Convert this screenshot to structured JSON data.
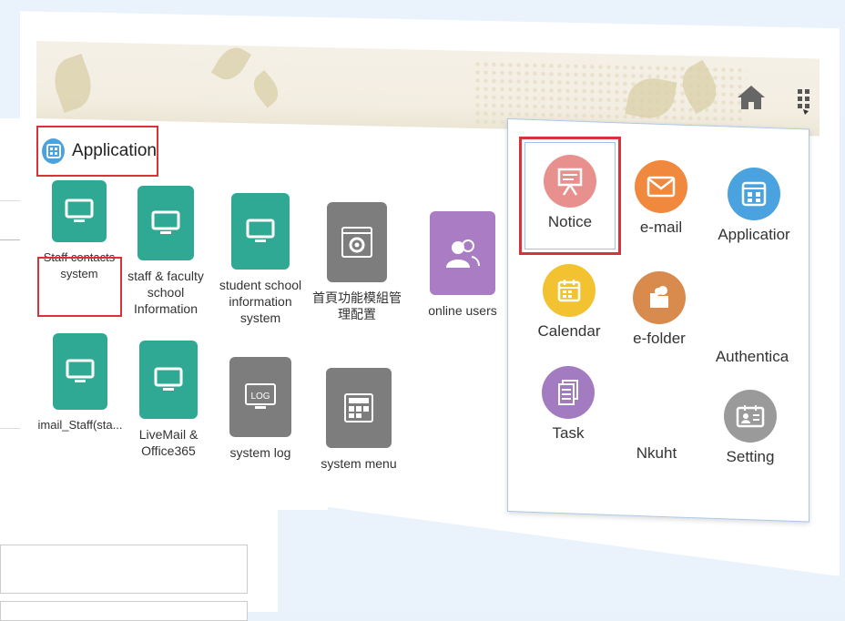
{
  "header": {
    "section_title": "Application"
  },
  "apps": [
    {
      "label": "Staff contacts system",
      "icon": "monitor-icon",
      "color": "#2fa894"
    },
    {
      "label": "staff & faculty school Information",
      "icon": "monitor-icon",
      "color": "#2fa894"
    },
    {
      "label": "student school information system",
      "icon": "monitor-icon",
      "color": "#2fa894"
    },
    {
      "label": "首頁功能模組管理配置",
      "icon": "gear-window-icon",
      "color": "#7d7d7d"
    },
    {
      "label": "online users",
      "icon": "users-icon",
      "color": "#a97cc4"
    },
    {
      "label": "imail_Staff(sta...",
      "icon": "monitor-icon",
      "color": "#2fa894"
    },
    {
      "label": "LiveMail & Office365",
      "icon": "monitor-icon",
      "color": "#2fa894"
    },
    {
      "label": "system log",
      "icon": "log-icon",
      "color": "#7d7d7d",
      "badge": "LOG"
    },
    {
      "label": "system menu",
      "icon": "menu-grid-icon",
      "color": "#7d7d7d"
    }
  ],
  "dropdown": {
    "items": [
      {
        "label": "Notice",
        "icon": "presentation-board-icon",
        "color": "#e8908e"
      },
      {
        "label": "e-mail",
        "icon": "envelope-icon",
        "color": "#f0883e"
      },
      {
        "label": "Applicatior",
        "icon": "app-grid-icon",
        "color": "#4aa3df"
      },
      {
        "label": "Calendar",
        "icon": "calendar-icon",
        "color": "#f2c230"
      },
      {
        "label": "e-folder",
        "icon": "folder-cloud-icon",
        "color": "#d98a4d"
      },
      {
        "label": "Authentica",
        "icon": "",
        "color": ""
      },
      {
        "label": "Task",
        "icon": "document-icon",
        "color": "#a27bc0"
      },
      {
        "label": "Nkuht",
        "icon": "",
        "color": ""
      },
      {
        "label": "Setting",
        "icon": "id-card-icon",
        "color": "#9a9a9a"
      }
    ]
  },
  "accent": "#d9333a"
}
